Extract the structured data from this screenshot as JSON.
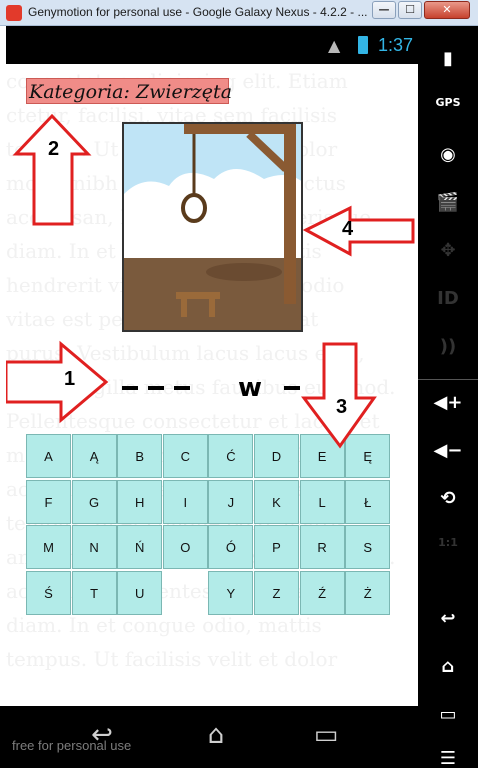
{
  "window": {
    "title": "Genymotion for personal use - Google Galaxy Nexus - 4.2.2 - ...",
    "min_glyph": "—",
    "max_glyph": "☐",
    "close_glyph": "✕"
  },
  "status_bar": {
    "time": "1:37",
    "wifi_icon": "wifi-icon",
    "battery_icon": "battery-icon",
    "accent": "#33b5e5"
  },
  "background_text_lines": [
    "consectetur adipiscing elit. Etiam",
    "ctetur, facilisi, vitae sem facilisis",
    "tempus. Ut facilisis velit et dolor",
    "mollis nibh elementum sed lectus",
    "accumsan, Pellentesque scelerisque",
    "diam. In et congue odio, mattis",
    "hendrerit vitae, pharetra vel odio",
    "vitae est pede fermentum in at",
    "purus. Vestibulum lacus lacus eros,",
    "ante fringilla metus faucibus euismod.",
    "Pellentesque consectetur et lacus, et",
    "mollis nibh elementum sed. Duis",
    "accumsan, Pellentesque scelerisque",
    "tempus. In et congue odio, mattis",
    "ante fringilla metus faucibus euismod.",
    "accumsan, Pellentesque scelerisque",
    "diam. In et congue odio, mattis",
    "tempus. Ut facilisis velit et dolor"
  ],
  "category": {
    "label": "Kategoria: Zwierzęta",
    "bg": "#f08c88"
  },
  "word": {
    "slots": [
      "",
      "",
      "",
      "w",
      ""
    ]
  },
  "keyboard": {
    "key_color": "#b2ebe8",
    "rows": [
      [
        "A",
        "Ą",
        "B",
        "C",
        "Ć",
        "D",
        "E",
        "Ę"
      ],
      [
        "F",
        "G",
        "H",
        "I",
        "J",
        "K",
        "L",
        "Ł"
      ],
      [
        "M",
        "N",
        "Ń",
        "O",
        "Ó",
        "P",
        "R",
        "S"
      ],
      [
        "Ś",
        "T",
        "U",
        "",
        "Y",
        "Z",
        "Ź",
        "Ż"
      ]
    ]
  },
  "callouts": [
    "1",
    "2",
    "3",
    "4"
  ],
  "callout_color": "#e02020",
  "sidebar_icons": [
    {
      "name": "battery-icon",
      "glyph": "▮",
      "enabled": true
    },
    {
      "name": "gps-icon",
      "glyph": "GPS",
      "enabled": true
    },
    {
      "name": "camera-icon",
      "glyph": "◉",
      "enabled": true
    },
    {
      "name": "video-icon",
      "glyph": "🎬",
      "enabled": false
    },
    {
      "name": "dpad-icon",
      "glyph": "✥",
      "enabled": false
    },
    {
      "name": "id-icon",
      "glyph": "ID",
      "enabled": false
    },
    {
      "name": "rss-icon",
      "glyph": "))",
      "enabled": false
    },
    {
      "name": "volume-up-icon",
      "glyph": "◀+",
      "enabled": true
    },
    {
      "name": "volume-down-icon",
      "glyph": "◀−",
      "enabled": true
    },
    {
      "name": "rotate-icon",
      "glyph": "⟲",
      "enabled": true
    },
    {
      "name": "scale-icon",
      "glyph": "1:1",
      "enabled": false
    },
    {
      "name": "back-icon",
      "glyph": "↩",
      "enabled": true
    },
    {
      "name": "home-icon",
      "glyph": "⌂",
      "enabled": true
    },
    {
      "name": "recents-icon",
      "glyph": "▭",
      "enabled": true
    },
    {
      "name": "menu-icon",
      "glyph": "☰",
      "enabled": true
    }
  ],
  "nav_bar": {
    "back_icon": "back-arrow-icon",
    "home_icon": "home-icon",
    "recents_icon": "recents-icon",
    "watermark": "free for personal use"
  }
}
